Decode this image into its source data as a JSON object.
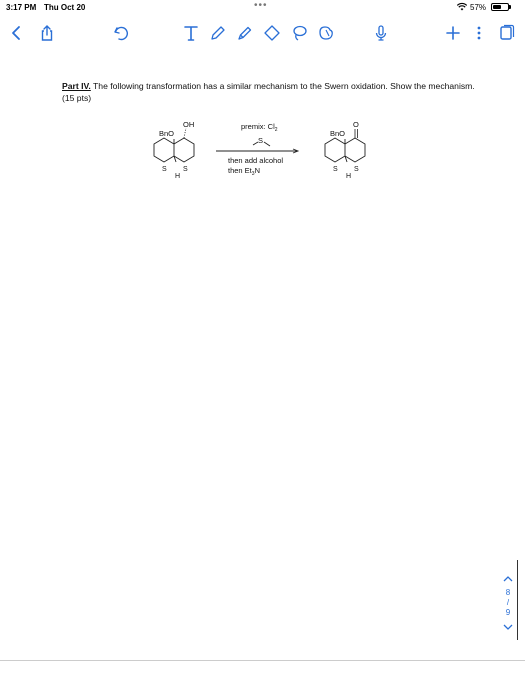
{
  "status": {
    "time": "3:17 PM",
    "date": "Thu Oct 20",
    "more_dots": "•••",
    "battery_pct": "57%",
    "battery_level": 0.57
  },
  "toolbar": {
    "accent_color": "#2a6fd6",
    "icons_left": [
      "back-icon",
      "share-icon",
      "undo-icon"
    ],
    "icons_tools": [
      "text-tool-icon",
      "pen-icon",
      "highlighter-icon",
      "eraser-icon",
      "lasso-icon",
      "shapes-icon",
      "microphone-icon"
    ],
    "icons_right": [
      "add-icon",
      "more-icon",
      "pages-icon"
    ]
  },
  "page": {
    "part_label": "Part IV.",
    "instruction": " The following transformation has a similar mechanism to the Swern oxidation. Show the mechanism. (15 pts)"
  },
  "scheme": {
    "reactant_oh": "OH",
    "reactant_bno": "BnO",
    "reactant_s_left": "S",
    "reactant_s_right": "S",
    "reactant_h": "H",
    "arrow_above_line1": "premix: Cl",
    "arrow_above_line1_sub": "2",
    "arrow_above_reagent": "S",
    "arrow_below_line1": "then add alcohol",
    "arrow_below_line2": "then Et",
    "arrow_below_line2_sub": "3",
    "arrow_below_line2_end": "N",
    "product_o": "O",
    "product_bno": "BnO",
    "product_s_left": "S",
    "product_s_right": "S",
    "product_h": "H"
  },
  "page_nav": {
    "current": "8",
    "separator": "/",
    "total": "9"
  }
}
